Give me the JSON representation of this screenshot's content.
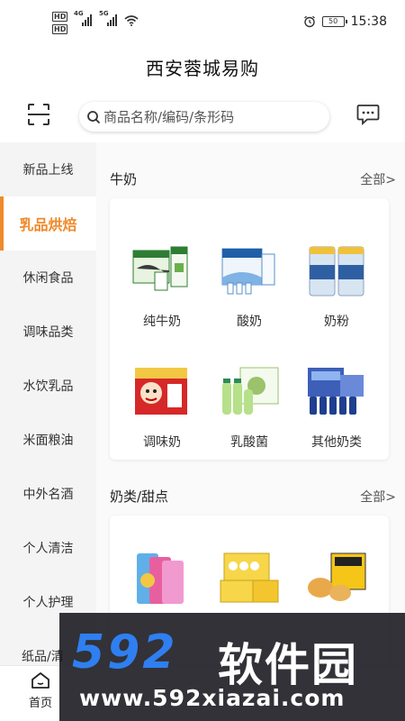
{
  "status_bar": {
    "hd1": "HD",
    "hd2": "HD",
    "net1": "4G",
    "net2": "5G",
    "battery": "50",
    "time": "15:38"
  },
  "app": {
    "title": "西安蓉城易购"
  },
  "search": {
    "placeholder": "商品名称/编码/条形码"
  },
  "sidebar": {
    "items": [
      {
        "label": "新品上线"
      },
      {
        "label": "乳品烘焙"
      },
      {
        "label": "休闲食品"
      },
      {
        "label": "调味品类"
      },
      {
        "label": "水饮乳品"
      },
      {
        "label": "米面粮油"
      },
      {
        "label": "中外名酒"
      },
      {
        "label": "个人清洁"
      },
      {
        "label": "个人护理"
      },
      {
        "label": "纸品/清"
      }
    ],
    "active_index": 1
  },
  "sections": [
    {
      "title": "牛奶",
      "more": "全部>",
      "items": [
        {
          "label": "纯牛奶",
          "icon": "milk-box-product"
        },
        {
          "label": "酸奶",
          "icon": "yogurt-product"
        },
        {
          "label": "奶粉",
          "icon": "milk-powder-can-product"
        },
        {
          "label": "调味奶",
          "icon": "flavored-milk-product"
        },
        {
          "label": "乳酸菌",
          "icon": "lactic-acid-drink-product"
        },
        {
          "label": "其他奶类",
          "icon": "other-milk-product"
        }
      ]
    },
    {
      "title": "奶类/甜点",
      "more": "全部>",
      "items": [
        {
          "label": "",
          "icon": "snack-pack-product"
        },
        {
          "label": "",
          "icon": "egg-box-product"
        },
        {
          "label": "",
          "icon": "bread-box-product"
        }
      ]
    }
  ],
  "bottom_nav": {
    "home_label": "首页"
  },
  "watermark": {
    "big": "592",
    "cn": "软件园",
    "url": "www.592xiazai.com"
  },
  "colors": {
    "accent": "#f08a2c",
    "sidebar_bg": "#f4f4f4",
    "watermark_blue": "#2f7ff0"
  }
}
